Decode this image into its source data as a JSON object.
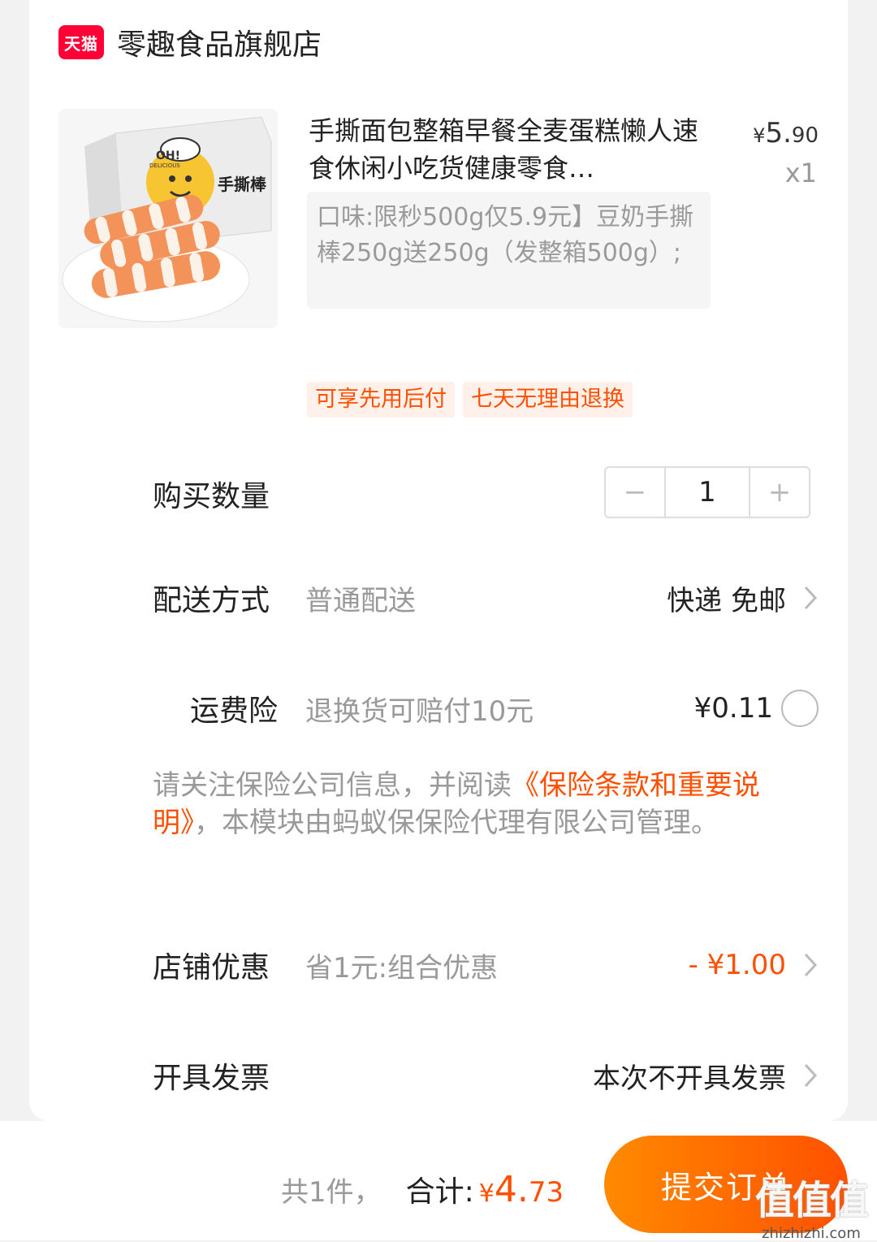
{
  "shop": {
    "badge": "天猫",
    "name": "零趣食品旗舰店"
  },
  "product": {
    "title": "手撕面包整箱早餐全麦蛋糕懒人速食休闲小吃货健康零食…",
    "price_currency": "¥",
    "price_int": "5.",
    "price_dec": "90",
    "quantity_label": "x1",
    "sku": "口味:限秒500g仅5.9元】豆奶手撕棒250g送250g（发整箱500g）;",
    "image_texts": {
      "box_brand": "OH!",
      "box_sub": "DELICIOUS",
      "box_name": "手撕棒"
    }
  },
  "tags": [
    "可享先用后付",
    "七天无理由退换"
  ],
  "quantity": {
    "label": "购买数量",
    "value": "1",
    "minus": "−",
    "plus": "+"
  },
  "delivery": {
    "label": "配送方式",
    "sub": "普通配送",
    "value": "快递 免邮"
  },
  "insurance": {
    "label": "运费险",
    "sub": "退换货可赔付10元",
    "value": "¥0.11"
  },
  "notice": {
    "prefix": "请关注保险公司信息，并阅读",
    "link": "《保险条款和重要说明》",
    "suffix": "，本模块由蚂蚁保保险代理有限公司管理。"
  },
  "discount": {
    "label": "店铺优惠",
    "sub": "省1元:组合优惠",
    "value": "- ¥1.00"
  },
  "invoice": {
    "label": "开具发票",
    "value": "本次不开具发票"
  },
  "footer": {
    "count": "共1件，",
    "total_label": "合计:",
    "total_currency": "¥",
    "total_int": "4.",
    "total_dec": "73",
    "submit": "提交订单"
  },
  "watermark": {
    "main": "值值值",
    "site": "zhizhizhi.com"
  },
  "colors": {
    "accent": "#ff5000",
    "tmall": "#ff0036"
  }
}
